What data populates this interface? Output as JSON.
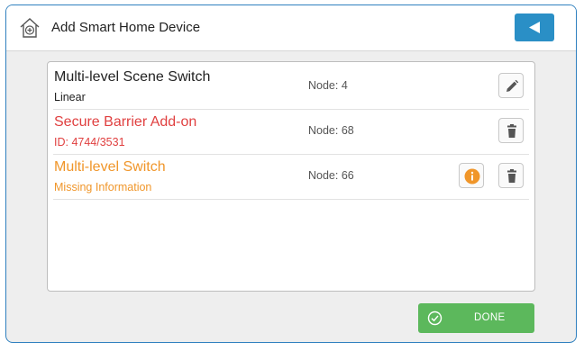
{
  "header": {
    "title": "Add Smart Home Device",
    "home_icon": "home-plus-icon",
    "back_icon": "back-arrow-icon"
  },
  "devices": [
    {
      "name": "Multi-level Scene Switch",
      "subtitle": "Linear",
      "node": "Node: 4",
      "color": "#222222",
      "sub_color": "#222222",
      "actions": [
        "edit-icon"
      ]
    },
    {
      "name": "Secure Barrier Add-on",
      "subtitle": "ID: 4744/3531",
      "node": "Node: 68",
      "color": "#e04040",
      "sub_color": "#e04040",
      "actions": [
        "trash-icon"
      ]
    },
    {
      "name": "Multi-level Switch",
      "subtitle": "Missing Information",
      "node": "Node: 66",
      "color": "#f0962a",
      "sub_color": "#f0962a",
      "actions": [
        "info-icon",
        "trash-icon"
      ]
    }
  ],
  "footer": {
    "done_label": "DONE",
    "done_icon": "check-circle-icon"
  },
  "colors": {
    "accent": "#2a8fc6",
    "done": "#5cb85c",
    "warning": "#f0962a",
    "error": "#e04040"
  }
}
